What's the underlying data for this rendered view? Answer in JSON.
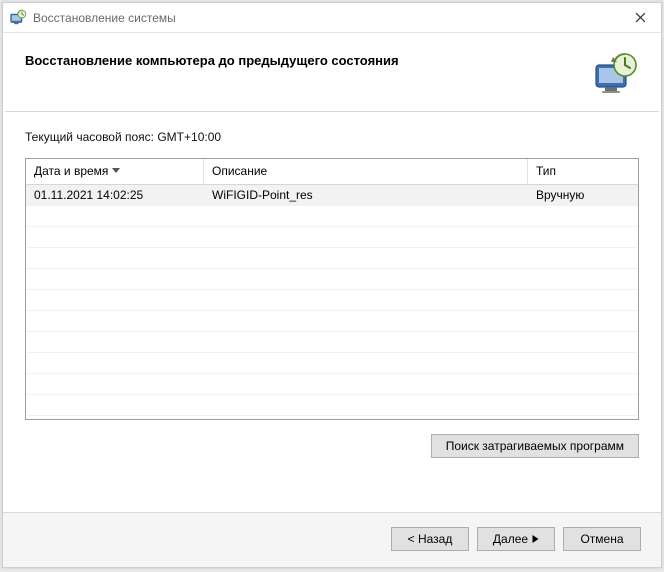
{
  "titlebar": {
    "title": "Восстановление системы"
  },
  "header": {
    "heading": "Восстановление компьютера до предыдущего состояния"
  },
  "content": {
    "timezone_line": "Текущий часовой пояс: GMT+10:00",
    "columns": {
      "datetime": "Дата и время",
      "description": "Описание",
      "type": "Тип"
    },
    "rows": [
      {
        "datetime": "01.11.2021 14:02:25",
        "description": "WiFIGID-Point_res",
        "type": "Вручную"
      }
    ],
    "scan_button": "Поиск затрагиваемых программ"
  },
  "footer": {
    "back": "< Назад",
    "next": "Далее",
    "cancel": "Отмена"
  }
}
